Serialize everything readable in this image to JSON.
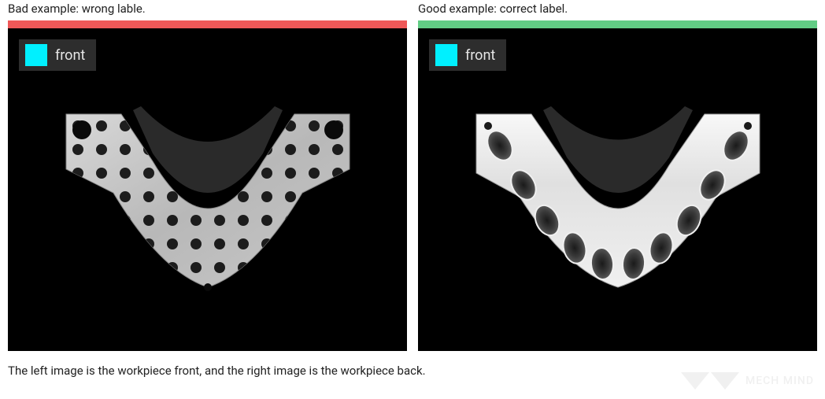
{
  "examples": {
    "bad": {
      "title": "Bad example: wrong lable.",
      "status_color": "#ef5858",
      "label": {
        "text": "front",
        "swatch_color": "#00f0ff"
      }
    },
    "good": {
      "title": "Good example: correct label.",
      "status_color": "#62cd85",
      "label": {
        "text": "front",
        "swatch_color": "#00f0ff"
      }
    }
  },
  "caption": "The left image is the workpiece front, and the right image is the workpiece back.",
  "watermark": {
    "text": "MECH MIND"
  }
}
